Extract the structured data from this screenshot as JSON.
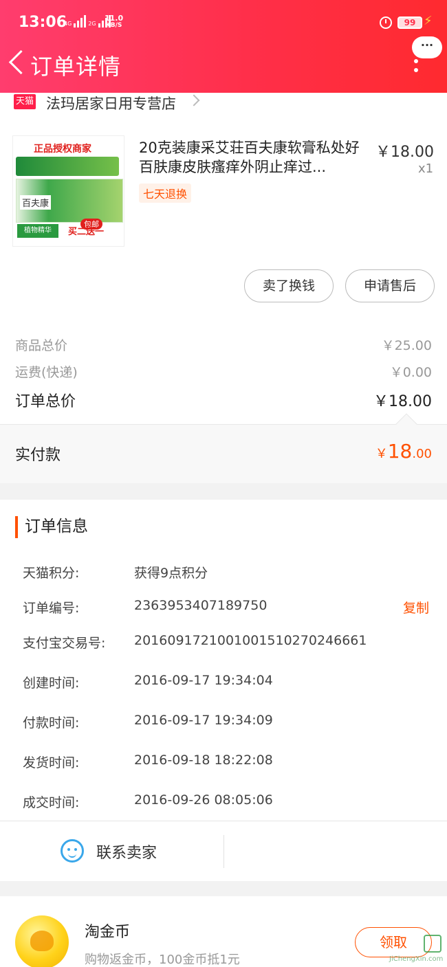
{
  "status_bar": {
    "time": "13:06",
    "net1": "4G",
    "net2": "2G",
    "speed_value": "11.0",
    "speed_unit": "KB/S",
    "battery": "99"
  },
  "header": {
    "title": "订单详情",
    "more": "···"
  },
  "store": {
    "badge": "天猫",
    "name": "法玛居家日用专营店"
  },
  "product": {
    "title": "20克装康采艾荘百夫康软膏私处好百肤康皮肤瘙痒外阴止痒过...",
    "price": "￥18.00",
    "qty": "x1",
    "tag": "七天退换",
    "thumb_auth": "正品授权商家",
    "thumb_brand": "百夫康",
    "thumb_baoyou": "包邮",
    "thumb_promo": "买二送一",
    "thumb_leaf": "植物精华"
  },
  "actions": {
    "sell": "卖了换钱",
    "after_sale": "申请售后"
  },
  "summary": {
    "goods_label": "商品总价",
    "goods_value": "￥25.00",
    "ship_label": "运费(快递)",
    "ship_value": "￥0.00",
    "total_label": "订单总价",
    "total_value": "￥18.00",
    "paid_label": "实付款",
    "paid_currency": "￥",
    "paid_int": "18",
    "paid_dec": ".00"
  },
  "order_info": {
    "heading": "订单信息",
    "rows": [
      {
        "label": "天猫积分:",
        "value": "获得9点积分"
      },
      {
        "label": "订单编号:",
        "value": "2363953407189750"
      },
      {
        "label": "支付宝交易号:",
        "value": "2016091721001001510270246661"
      },
      {
        "label": "创建时间:",
        "value": "2016-09-17 19:34:04"
      },
      {
        "label": "付款时间:",
        "value": "2016-09-17 19:34:09"
      },
      {
        "label": "发货时间:",
        "value": "2016-09-18 18:22:08"
      },
      {
        "label": "成交时间:",
        "value": "2016-09-26 08:05:06"
      }
    ],
    "copy": "复制",
    "contact": "联系卖家"
  },
  "coins": {
    "title": "淘金币",
    "subtitle": "购物返金币，100金币抵1元",
    "claim": "领取"
  },
  "watermark": {
    "text": "JiChengXin.com"
  },
  "colors": {
    "accent": "#ff5000",
    "header_start": "#ff3d6e",
    "header_end": "#ff2a2f"
  }
}
